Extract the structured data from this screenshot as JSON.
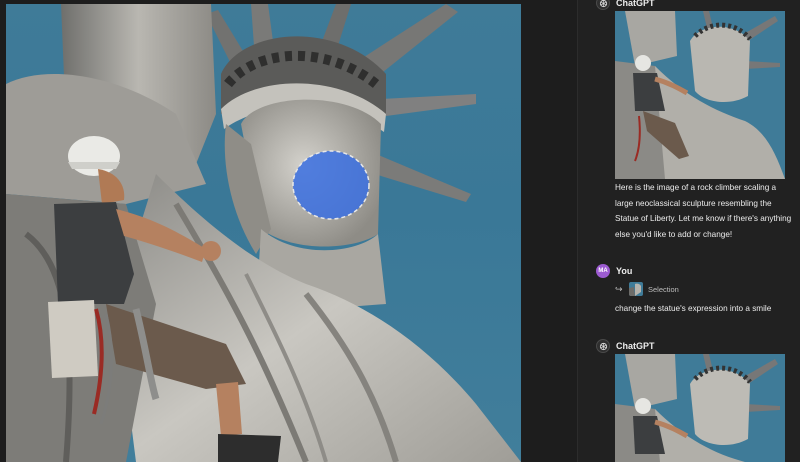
{
  "chat": {
    "messages": [
      {
        "sender": "ChatGPT",
        "text": "Here is the image of a rock climber scaling a large neoclassical sculpture resembling the Statue of Liberty. Let me know if there's anything else you'd like to add or change!"
      },
      {
        "sender": "You",
        "avatar_initials": "MA",
        "selection_label": "Selection",
        "text": "change the statue's expression into a smile"
      },
      {
        "sender": "ChatGPT"
      }
    ]
  },
  "editor": {
    "selection_color": "#3a6fe0"
  },
  "colors": {
    "background": "#212121",
    "sky": "#3f7b98",
    "user_avatar": "#9c5bd1"
  },
  "icons": [
    "openai-logo-icon",
    "reply-arrow-icon"
  ]
}
